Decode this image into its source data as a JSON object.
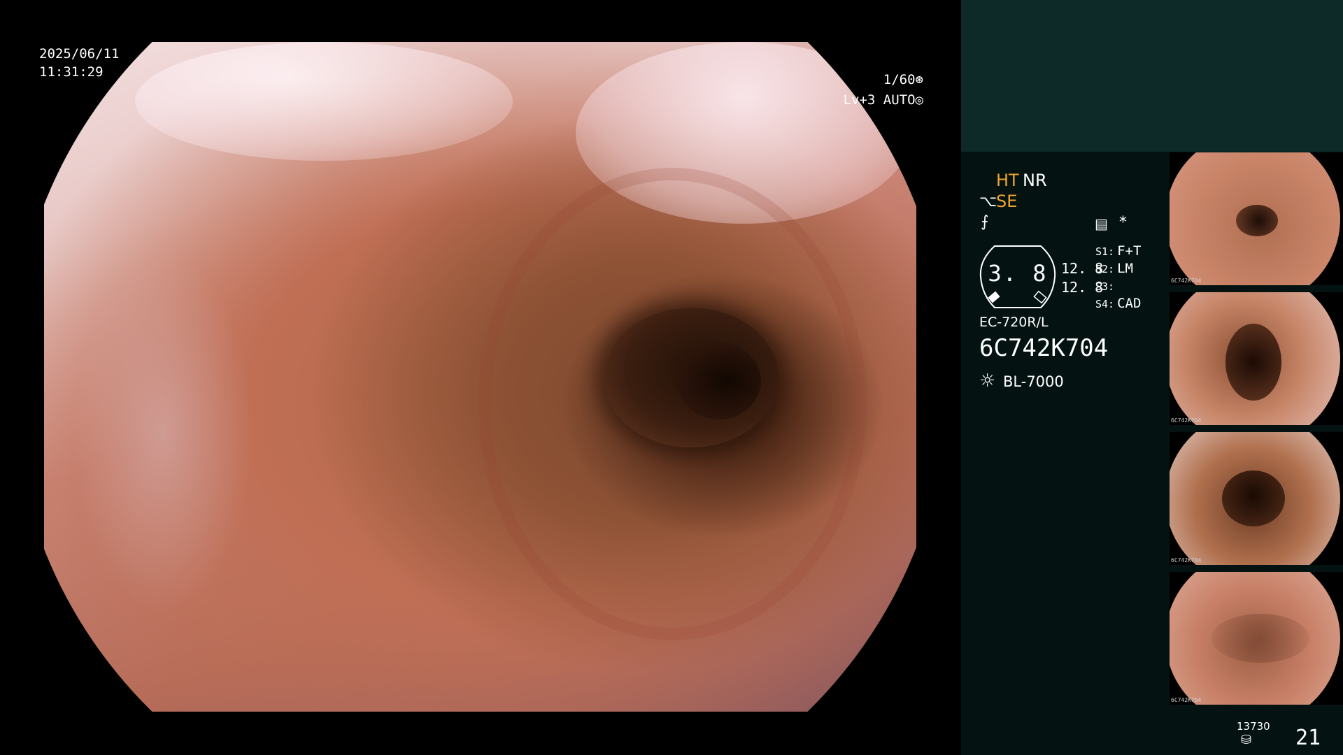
{
  "overlay": {
    "date": "2025/06/11",
    "time": "11:31:29",
    "shutter": "1/60",
    "level": "Lv+3",
    "iris": "AUTO"
  },
  "panel": {
    "ht": "HT",
    "nr": "NR",
    "se": "SE",
    "gauge_value": "3. 8",
    "gauge_sub_1": "12. 8",
    "gauge_sub_2": "12. 8",
    "slots": [
      {
        "key": "S1:",
        "value": "F+T"
      },
      {
        "key": "S2:",
        "value": "LM"
      },
      {
        "key": "S3:",
        "value": ""
      },
      {
        "key": "S4:",
        "value": "CAD"
      }
    ],
    "scope_model": "EC-720R/L",
    "scope_serial": "6C742K704",
    "light_source": "BL-7000",
    "frame_count": "13730",
    "image_count": "21",
    "accent_color": "#f0a42c"
  },
  "thumbnails": [
    {
      "caption": "6C742K704"
    },
    {
      "caption": "6C742K704"
    },
    {
      "caption": "6C742K704"
    },
    {
      "caption": "6C742K704"
    }
  ],
  "icons": {
    "shutter": "shutter-icon",
    "iris": "iris-icon",
    "structure_enhance": "structure-icon",
    "color_curve": "curve-icon",
    "menu": "menu-icon",
    "light": "light-icon",
    "storage": "disk-icon"
  }
}
